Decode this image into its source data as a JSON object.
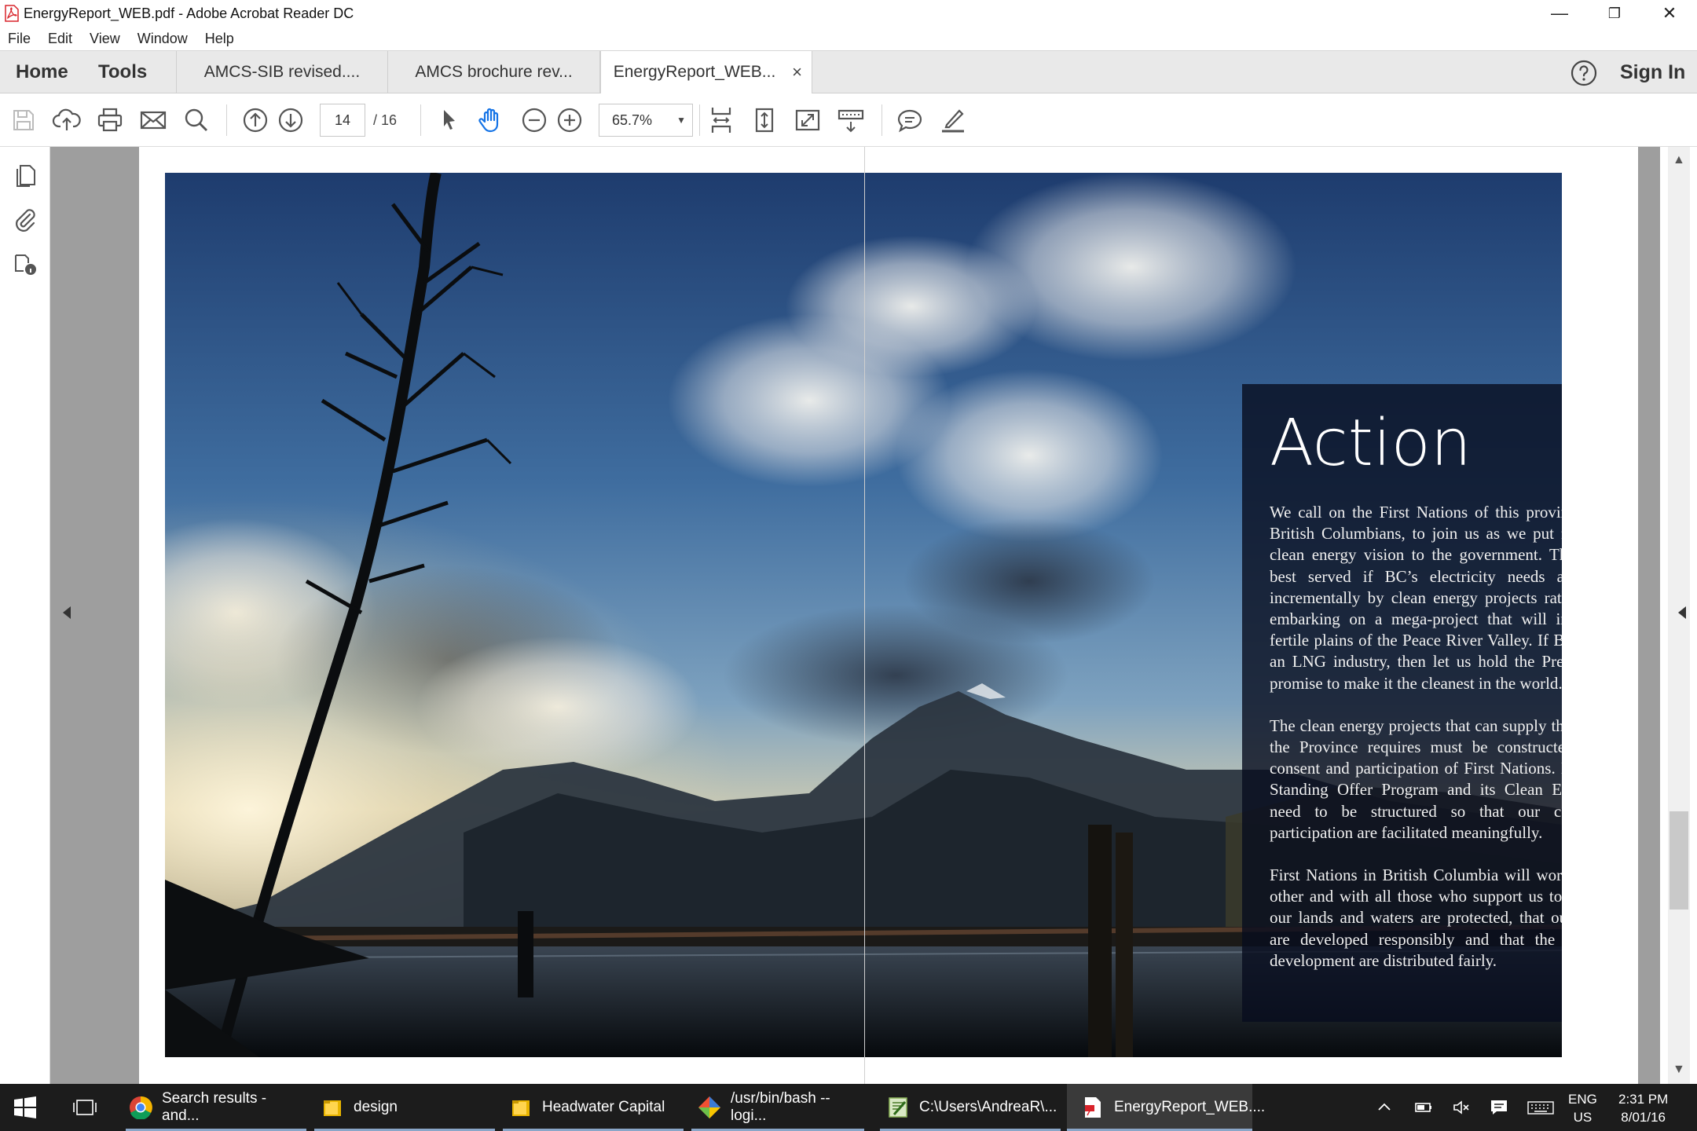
{
  "window": {
    "title": "EnergyReport_WEB.pdf - Adobe Acrobat Reader DC",
    "minimize": "—",
    "restore": "❐",
    "close": "✕"
  },
  "menu": [
    "File",
    "Edit",
    "View",
    "Window",
    "Help"
  ],
  "tabs": {
    "home": "Home",
    "tools": "Tools",
    "documents": [
      {
        "label": "AMCS-SIB revised....",
        "active": false
      },
      {
        "label": "AMCS brochure rev...",
        "active": false
      },
      {
        "label": "EnergyReport_WEB...",
        "active": true
      }
    ],
    "close_glyph": "×",
    "sign_in": "Sign In"
  },
  "toolbar": {
    "current_page": "14",
    "total_pages": "/  16",
    "zoom": "65.7%",
    "zoom_caret": "▼"
  },
  "document": {
    "heading": "Action",
    "paragraphs": [
      "We call on the First Nations of this province, and all British Columbians, to join us as we put forward our clean energy vision to the government. The public is best served if BC’s electricity needs are fulfilled incrementally by clean energy projects rather than by embarking on a mega-project that will inundate the fertile plains of the Peace River Valley. If BC is to host an LNG industry, then let us hold the Premier to her promise to make it the cleanest in the world.",
      "The clean energy projects that can supply the electricity the Province requires must be constructed with the consent and participation of First Nations. BC Hydro’s Standing Offer Program and its Clean Energy Calls need to be structured so that our consent and participation are facilitated meaningfully.",
      "First Nations in British Columbia will work with each other and with all those who support us to ensure that our lands and waters are protected, that our resources are developed responsibly and that the benefits of development are distributed fairly."
    ]
  },
  "scrollbar": {
    "up": "▲",
    "down": "▼",
    "position_fraction": 0.81
  },
  "taskbar": {
    "items": [
      {
        "label": "Search results - and...",
        "icon": "chrome-icon"
      },
      {
        "label": "design",
        "icon": "folder-icon"
      },
      {
        "label": "Headwater Capital",
        "icon": "folder-icon"
      },
      {
        "label": "/usr/bin/bash --logi...",
        "icon": "git-bash-icon"
      },
      {
        "label": "C:\\Users\\AndreaR\\...",
        "icon": "notepad-icon"
      },
      {
        "label": "EnergyReport_WEB....",
        "icon": "acrobat-icon"
      }
    ],
    "language": "ENG",
    "region": "US",
    "time": "2:31 PM",
    "date": "8/01/16"
  },
  "colors": {
    "accent": "#1473e6",
    "taskbar": "#1c1c1c",
    "doc_background": "#9e9e9e",
    "acrobat_red": "#d8232a"
  }
}
